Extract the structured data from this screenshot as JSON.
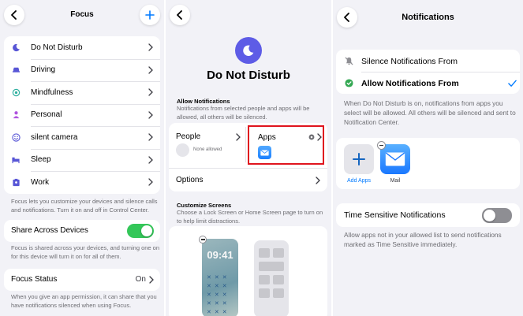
{
  "focus": {
    "title": "Focus",
    "items": [
      {
        "label": "Do Not Disturb",
        "icon": "moon-icon",
        "color": "#5856d6"
      },
      {
        "label": "Driving",
        "icon": "car-icon",
        "color": "#5856d6"
      },
      {
        "label": "Mindfulness",
        "icon": "flower-icon",
        "color": "#30b0a0"
      },
      {
        "label": "Personal",
        "icon": "person-icon",
        "color": "#af52de"
      },
      {
        "label": "silent camera",
        "icon": "smiley-icon",
        "color": "#5856d6"
      },
      {
        "label": "Sleep",
        "icon": "bed-icon",
        "color": "#5856d6"
      },
      {
        "label": "Work",
        "icon": "id-badge-icon",
        "color": "#5856d6"
      }
    ],
    "list_footer": "Focus lets you customize your devices and silence calls and notifications. Turn it on and off in Control Center.",
    "share_label": "Share Across Devices",
    "share_footer": "Focus is shared across your devices, and turning one on for this device will turn it on for all of them.",
    "status_label": "Focus Status",
    "status_value": "On",
    "status_footer": "When you give an app permission, it can share that you have notifications silenced when using Focus."
  },
  "dnd": {
    "title": "Do Not Disturb",
    "allow_header": "Allow Notifications",
    "allow_desc": "Notifications from selected people and apps will be allowed, all others will be silenced.",
    "people_label": "People",
    "people_none": "None allowed",
    "apps_label": "Apps",
    "options_label": "Options",
    "screens_header": "Customize Screens",
    "screens_desc": "Choose a Lock Screen or Home Screen page to turn on to help limit distractions.",
    "lock_time": "09:41"
  },
  "notifications": {
    "title": "Notifications",
    "silence_label": "Silence Notifications From",
    "allow_label": "Allow Notifications From",
    "allow_footer": "When Do Not Disturb is on, notifications from apps you select will be allowed. All others will be silenced and sent to Notification Center.",
    "add_apps_label": "Add Apps",
    "mail_label": "Mail",
    "time_sensitive_label": "Time Sensitive Notifications",
    "time_sensitive_footer": "Allow apps not in your allowed list to send notifications marked as Time Sensitive immediately."
  },
  "colors": {
    "accent": "#007aff",
    "toggle_on": "#34c759",
    "toggle_off": "#8e8e93",
    "highlight_box": "#e0141e",
    "dnd_purple": "#5e5ce6"
  }
}
